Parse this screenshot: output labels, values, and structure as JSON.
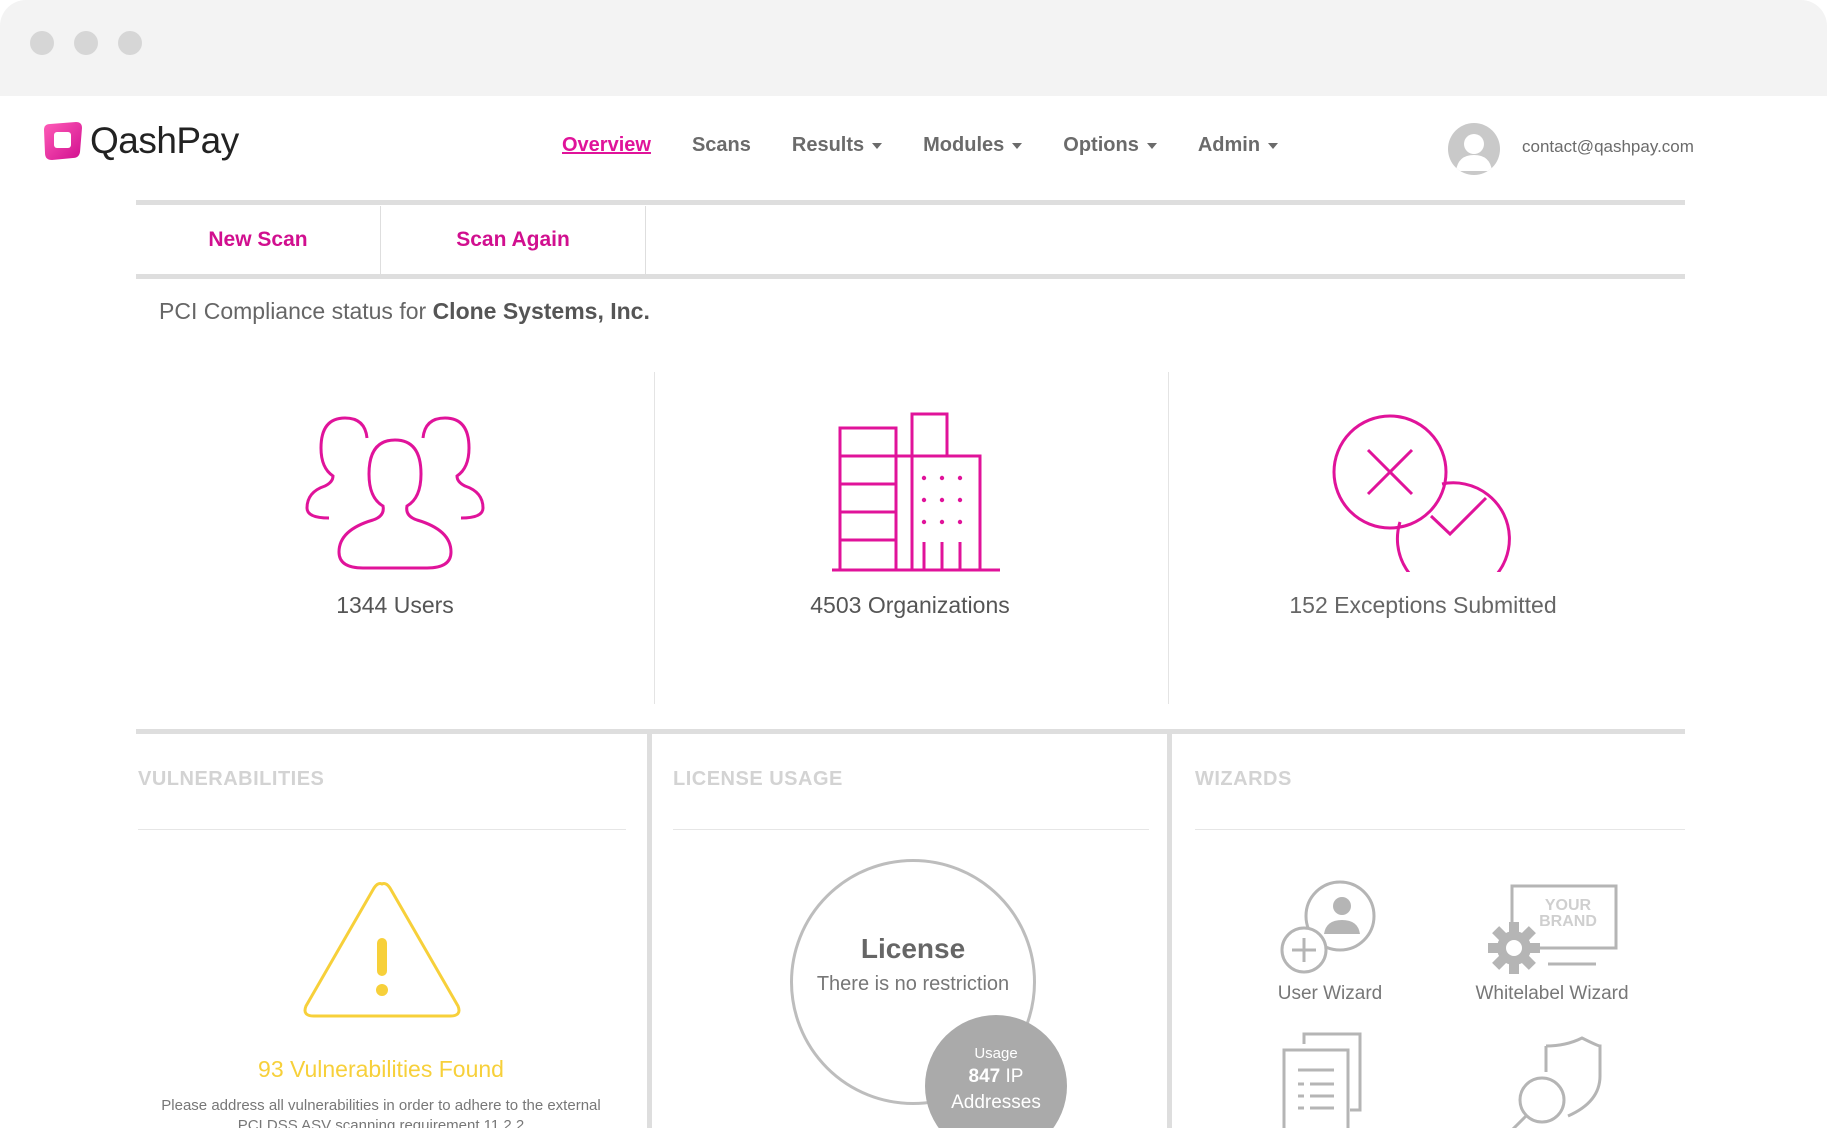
{
  "brand": {
    "name": "QashPay",
    "accent": "#e0139a",
    "logo_gradient": [
      "#ff4fb5",
      "#d10f8f"
    ]
  },
  "nav": {
    "items": [
      {
        "label": "Overview",
        "active": true,
        "dropdown": false
      },
      {
        "label": "Scans",
        "active": false,
        "dropdown": false
      },
      {
        "label": "Results",
        "active": false,
        "dropdown": true
      },
      {
        "label": "Modules",
        "active": false,
        "dropdown": true
      },
      {
        "label": "Options",
        "active": false,
        "dropdown": true
      },
      {
        "label": "Admin",
        "active": false,
        "dropdown": true
      }
    ]
  },
  "user": {
    "email": "contact@qashpay.com",
    "avatar_icon": "user-avatar-icon"
  },
  "toolbar": {
    "new_scan": "New Scan",
    "scan_again": "Scan Again"
  },
  "status": {
    "prefix": "PCI Compliance status for ",
    "company": "Clone Systems, Inc."
  },
  "stats": {
    "users": {
      "label": "1344 Users",
      "icon": "users-icon",
      "color": "#e0139a"
    },
    "organizations": {
      "label": "4503 Organizations",
      "icon": "building-icon",
      "color": "#e0139a"
    },
    "exceptions": {
      "label": "152 Exceptions Submitted",
      "icon": "exceptions-icon",
      "color": "#666666"
    }
  },
  "panels": {
    "vulnerabilities": {
      "title": "VULNERABILITIES",
      "label": "93 Vulnerabilities Found",
      "description_line1": "Please address all vulnerabilities in order to adhere to the external",
      "description_line2": "PCI DSS ASV scanning requirement 11.2.2",
      "icon": "warning-icon",
      "color": "#f7d03a"
    },
    "license": {
      "title": "LICENSE USAGE",
      "heading": "License",
      "subtitle": "There is no restriction",
      "usage_small": "Usage",
      "usage_count": "847",
      "usage_unit": " IP",
      "usage_line3": "Addresses"
    },
    "wizards": {
      "title": "WIZARDS",
      "items": [
        {
          "label": "User Wizard",
          "icon": "user-wizard-icon"
        },
        {
          "label": "Whitelabel Wizard",
          "icon": "whitelabel-wizard-icon",
          "brand_text_1": "YOUR",
          "brand_text_2": "BRAND"
        },
        {
          "label": "",
          "icon": "documents-icon"
        },
        {
          "label": "",
          "icon": "shield-search-icon"
        }
      ]
    }
  }
}
